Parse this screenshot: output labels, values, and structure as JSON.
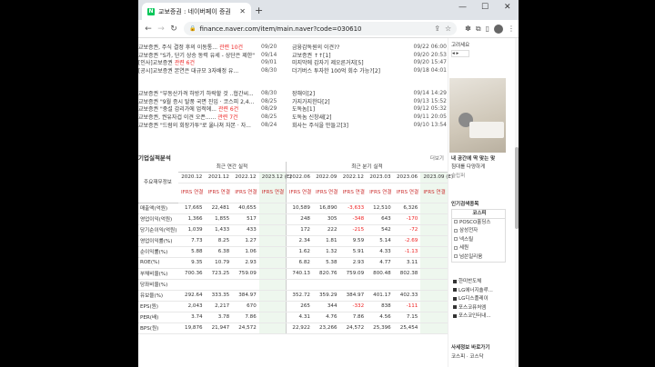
{
  "browser": {
    "tab_title": "교보증권 : 네이버페이 증권",
    "tab_icon_letter": "N",
    "url": "finance.naver.com/item/main.naver?code=030610",
    "minimize": "—",
    "maximize": "☐",
    "close": "✕",
    "newtab": "+",
    "tabclose": "✕"
  },
  "news": [
    {
      "t": "교보증권, 주식 결정 후의 이동통...",
      "hot": "관련 10건",
      "d": "09/20",
      "t2": "금융감독원의 이견??",
      "hot2": "",
      "d2": "09/22 06:00"
    },
    {
      "t": "교보증권 \"S가, 단기 상승 동력 유세 - 상단은 제한\"",
      "hot": "",
      "d": "09/14",
      "t2": "교보증권 ↑↑[1]",
      "hot2": "",
      "d2": "09/20 20:53"
    },
    {
      "t": "[인사]교보증권",
      "hot": "관련 6건",
      "d": "09/01",
      "t2": "미지막에 갑자기 제오른거지[5]",
      "hot2": "",
      "d2": "09/20 15:47"
    },
    {
      "t": "[공시]교보증권 본연은 대규모 3자배정 유...",
      "hot": "",
      "d": "08/30",
      "t2": "더기버스 투자한 100억 회수 가능?[2]",
      "hot2": "",
      "d2": "09/18 04:01"
    },
    {
      "t": "교보증권 \"부동산가격 하방기 하락할 것 ..협간씨...",
      "hot": "",
      "d": "08/30",
      "t2": "장해이[2]",
      "hot2": "",
      "d2": "09/14 14:29"
    },
    {
      "t": "교보증권 \"9월 증시 탈풍 국면 진입 · 코스피 2,4...",
      "hot": "",
      "d": "08/25",
      "t2": "가지가지한다[2]",
      "hot2": "",
      "d2": "09/13 15:52"
    },
    {
      "t": "교보증권 \"중설 감리가에 업적에...",
      "hot": "관련 6건",
      "d": "08/29",
      "t2": "도독놈[1]",
      "hot2": "",
      "d2": "09/12 05:32"
    },
    {
      "t": "교보증권, 권유자겁 이견 오픈......",
      "hot": "관련 7건",
      "d": "08/25",
      "t2": "도독놈 신창새[2]",
      "hot2": "",
      "d2": "09/11 20:05"
    },
    {
      "t": "교보증권 \"드럼의 회장가투\"로 옮나쳐 자본 · 자...",
      "hot": "",
      "d": "08/24",
      "t2": "회사는 주식을 만들고[3]",
      "hot2": "",
      "d2": "09/10 13:54"
    }
  ],
  "section_title": "기업실적분석",
  "more_link": "더보기",
  "table": {
    "corner": "주요재무정보",
    "annual_header": "최근 연간 실적",
    "quarter_header": "최근 분기 실적",
    "periods": [
      "2020.12",
      "2021.12",
      "2022.12",
      "2023.12 (E)",
      "2022.06",
      "2022.09",
      "2022.12",
      "2023.03",
      "2023.06",
      "2023.09 (E)"
    ],
    "ifrs": "IFRS 연결",
    "rows": [
      {
        "label": "매출액(억원)",
        "v": [
          "17,665",
          "22,481",
          "40,655",
          "",
          "10,589",
          "16,890",
          "-3,633",
          "12,510",
          "6,326",
          ""
        ]
      },
      {
        "label": "영업이익(억원)",
        "v": [
          "1,366",
          "1,855",
          "517",
          "",
          "248",
          "305",
          "-348",
          "643",
          "-170",
          ""
        ]
      },
      {
        "label": "당기순이익(억원)",
        "v": [
          "1,039",
          "1,433",
          "433",
          "",
          "172",
          "222",
          "-215",
          "542",
          "-72",
          ""
        ]
      },
      {
        "label": "영업이익률(%)",
        "v": [
          "7.73",
          "8.25",
          "1.27",
          "",
          "2.34",
          "1.81",
          "9.59",
          "5.14",
          "-2.69",
          ""
        ]
      },
      {
        "label": "순이익률(%)",
        "v": [
          "5.88",
          "6.38",
          "1.06",
          "",
          "1.62",
          "1.32",
          "5.91",
          "4.33",
          "-1.13",
          ""
        ]
      },
      {
        "label": "ROE(%)",
        "v": [
          "9.35",
          "10.79",
          "2.93",
          "",
          "6.82",
          "5.38",
          "2.93",
          "4.77",
          "3.11",
          ""
        ]
      },
      {
        "label": "부채비율(%)",
        "v": [
          "700.36",
          "723.25",
          "759.09",
          "",
          "740.13",
          "820.76",
          "759.09",
          "800.48",
          "802.38",
          ""
        ]
      },
      {
        "label": "당좌비율(%)",
        "v": [
          "",
          "",
          "",
          "",
          "",
          "",
          "",
          "",
          "",
          ""
        ]
      },
      {
        "label": "유보율(%)",
        "v": [
          "292.64",
          "333.35",
          "384.97",
          "",
          "352.72",
          "359.29",
          "384.97",
          "401.17",
          "402.33",
          ""
        ]
      },
      {
        "label": "EPS(원)",
        "v": [
          "2,043",
          "2,217",
          "670",
          "",
          "265",
          "344",
          "-332",
          "838",
          "-111",
          ""
        ]
      },
      {
        "label": "PER(배)",
        "v": [
          "3.74",
          "3.78",
          "7.86",
          "",
          "4.31",
          "4.76",
          "7.86",
          "4.56",
          "7.15",
          ""
        ]
      },
      {
        "label": "BPS(원)",
        "v": [
          "19,876",
          "21,947",
          "24,572",
          "",
          "22,922",
          "23,266",
          "24,572",
          "25,396",
          "25,454",
          ""
        ]
      }
    ]
  },
  "side": {
    "ad_label": "고려세요",
    "ad_title": "내 공간에 딱 맞는 맞",
    "ad_sub": "침대를 다양하게",
    "ad_brand": "슬립퍼",
    "popular_title": "인기검색종목",
    "kospi": "코스피",
    "stocks": [
      "POSCO홀딩스",
      "삼성전자",
      "넥스틸",
      "세원",
      "넘쓴일리움"
    ],
    "stocks2": [
      "한미반도체",
      "LG에너지솔루...",
      "LG디스플레이",
      "포스코퓨처엠",
      "포스코인터내..."
    ],
    "world_title": "사세정보 바로가기",
    "world_items": "코스피 · 코스닥"
  }
}
